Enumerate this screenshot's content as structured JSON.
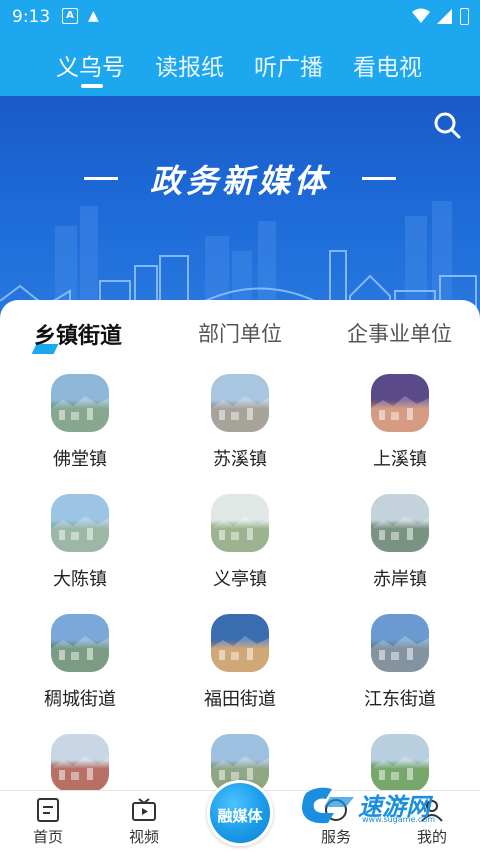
{
  "status": {
    "time": "9:13"
  },
  "topnav": {
    "tabs": [
      "义乌号",
      "读报纸",
      "听广播",
      "看电视"
    ],
    "active": 0
  },
  "banner": {
    "title": "政务新媒体"
  },
  "subtabs": [
    "乡镇街道",
    "部门单位",
    "企事业单位"
  ],
  "towns": [
    {
      "label": "佛堂镇",
      "sky": "#8fb8d8",
      "land": "#5f8a6a"
    },
    {
      "label": "苏溪镇",
      "sky": "#a9c6e0",
      "land": "#8a8478"
    },
    {
      "label": "上溪镇",
      "sky": "#5a4a8a",
      "land": "#c87a5a"
    },
    {
      "label": "大陈镇",
      "sky": "#9cc4e4",
      "land": "#7aa088"
    },
    {
      "label": "义亭镇",
      "sky": "#dfe8e4",
      "land": "#7a9a6a"
    },
    {
      "label": "赤岸镇",
      "sky": "#c4d2dc",
      "land": "#4c6f58"
    },
    {
      "label": "稠城街道",
      "sky": "#7aa8d8",
      "land": "#4f7a5a"
    },
    {
      "label": "福田街道",
      "sky": "#3a6db0",
      "land": "#c08a4a"
    },
    {
      "label": "江东街道",
      "sky": "#6a9ad0",
      "land": "#5a7080"
    },
    {
      "label": "",
      "sky": "#c8d6e6",
      "land": "#a04030"
    },
    {
      "label": "",
      "sky": "#9ec0e0",
      "land": "#6a8a5a"
    },
    {
      "label": "",
      "sky": "#b8cfe0",
      "land": "#4a8a3a"
    }
  ],
  "bottomnav": {
    "home": "首页",
    "video": "视频",
    "center": "融媒体",
    "service": "服务",
    "mine": "我的"
  },
  "watermark": {
    "text": "速游网",
    "sub": "www.sugame.com"
  },
  "colors": {
    "primary": "#1ca7ee",
    "banner": "#1d6ad8"
  }
}
